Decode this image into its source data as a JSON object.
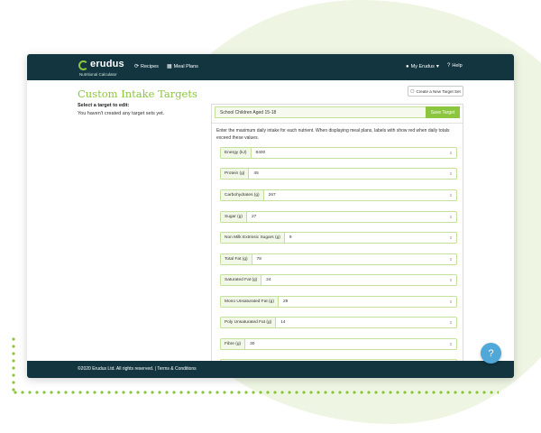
{
  "nav": {
    "brand_name": "erudus",
    "brand_subtitle": "Nutritional Calculator",
    "recipes": "Recipes",
    "meal_plans": "Meal Plans",
    "account": "My Erudus",
    "help": "Help"
  },
  "page": {
    "title": "Custom Intake Targets",
    "new_set_button": "Create a New Target Set",
    "select_label": "Select a target to edit:",
    "no_sets": "You haven't created any target sets yet."
  },
  "form": {
    "target_name": "School Children Aged 15-18",
    "save_button": "Save Target",
    "instructions": "Enter the maximum daily intake for each nutrient. When displaying meal plans, labels with show red when daily totals exceed these values.",
    "fields": [
      {
        "label": "Energy (kJ)",
        "value": "8400"
      },
      {
        "label": "Protein (g)",
        "value": "45"
      },
      {
        "label": "Carbohydrates (g)",
        "value": "267"
      },
      {
        "label": "Sugar (g)",
        "value": "27"
      },
      {
        "label": "Non Milk Extrinsic Sugars (g)",
        "value": "9"
      },
      {
        "label": "Total Fat (g)",
        "value": "78"
      },
      {
        "label": "Saturated Fat (g)",
        "value": "24"
      },
      {
        "label": "Mono Unsaturated Fat (g)",
        "value": "29"
      },
      {
        "label": "Poly Unsaturated Fat (g)",
        "value": "14"
      },
      {
        "label": "Fibre (g)",
        "value": "30"
      }
    ]
  },
  "footer": {
    "text": "©2020 Erudus Ltd. All rights reserved. | Terms & Conditions"
  },
  "help_bubble": "?",
  "colors": {
    "navbar": "#123540",
    "accent_green": "#8cc63f",
    "help_blue": "#4fa8d8"
  }
}
